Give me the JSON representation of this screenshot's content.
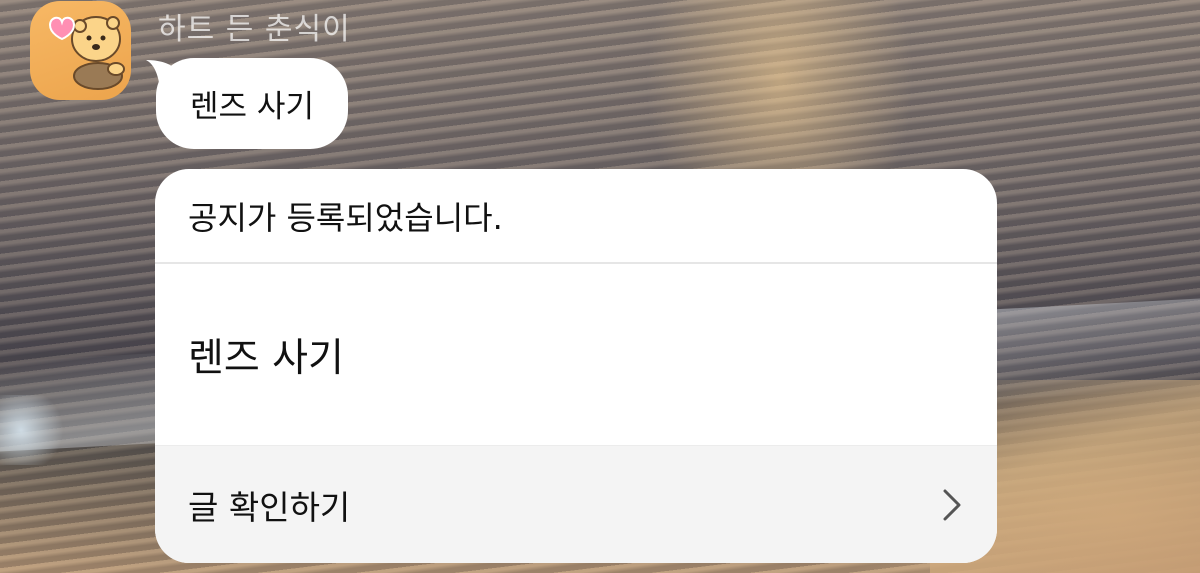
{
  "chat": {
    "sender_name": "하트 든 춘식이",
    "message": "렌즈 사기"
  },
  "notice": {
    "header": "공지가 등록되었습니다.",
    "content": "렌즈 사기",
    "action_label": "글 확인하기",
    "action_icon": "chevron-right-icon"
  },
  "colors": {
    "avatar_bg": "#f2ae57",
    "card_bg": "#ffffff",
    "footer_bg": "#f4f4f4"
  }
}
